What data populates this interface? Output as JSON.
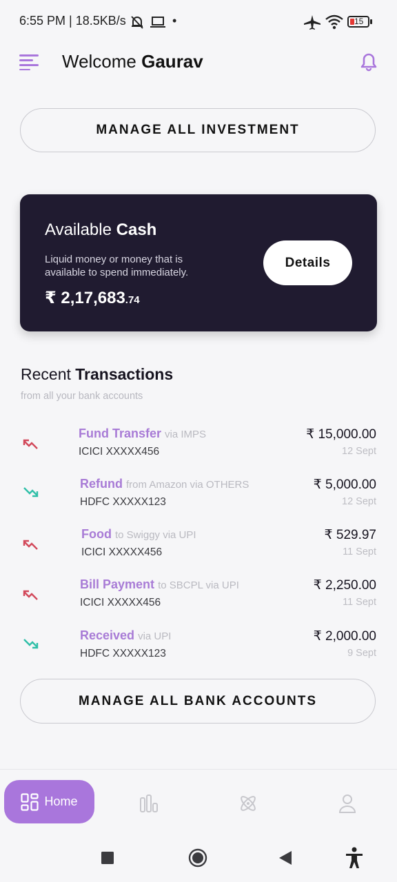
{
  "status_bar": {
    "time_speed": "6:55 PM | 18.5KB/s",
    "dot": "•",
    "battery": "15",
    "icons": [
      "do-not-disturb-icon",
      "laptop-icon",
      "airplane-mode-icon",
      "wifi-icon",
      "battery-icon"
    ]
  },
  "header": {
    "welcome": "Welcome",
    "name": "Gaurav",
    "icons": [
      "menu-icon",
      "bell-icon"
    ]
  },
  "manage_investment_label": "MANAGE ALL INVESTMENT",
  "cash_card": {
    "title_regular": "Available",
    "title_bold": "Cash",
    "description": "Liquid money or money that is available to spend immediately.",
    "amount_main": "₹ 2,17,683",
    "amount_decimal": ".74",
    "details_label": "Details"
  },
  "transactions_section": {
    "title_regular": "Recent",
    "title_bold": "Transactions",
    "subtitle": "from all your bank accounts"
  },
  "transactions": [
    {
      "title": "Fund Transfer",
      "note": "via IMPS",
      "account": "ICICI XXXXX456",
      "amount": "₹ 15,000.00",
      "date": "12 Sept",
      "direction": "debit"
    },
    {
      "title": "Refund",
      "note": "from Amazon via OTHERS",
      "account": "HDFC XXXXX123",
      "amount": "₹ 5,000.00",
      "date": "12 Sept",
      "direction": "credit"
    },
    {
      "title": "Food",
      "note": "to Swiggy via UPI",
      "account": "ICICI XXXXX456",
      "amount": "₹ 529.97",
      "date": "11 Sept",
      "direction": "debit"
    },
    {
      "title": "Bill Payment",
      "note": "to SBCPL via UPI",
      "account": "ICICI XXXXX456",
      "amount": "₹ 2,250.00",
      "date": "11 Sept",
      "direction": "debit"
    },
    {
      "title": "Received",
      "note": "via UPI",
      "account": "HDFC XXXXX123",
      "amount": "₹ 2,000.00",
      "date": "9 Sept",
      "direction": "credit"
    }
  ],
  "manage_bank_label": "MANAGE ALL BANK ACCOUNTS",
  "bottom_nav": {
    "home_label": "Home",
    "icons": [
      "home-grid-icon",
      "bar-chart-icon",
      "atom-icon",
      "profile-icon"
    ]
  },
  "colors": {
    "accent": "#a976dc",
    "card_bg": "#201b30",
    "debit": "#d2485a",
    "credit": "#2fbfa8"
  }
}
